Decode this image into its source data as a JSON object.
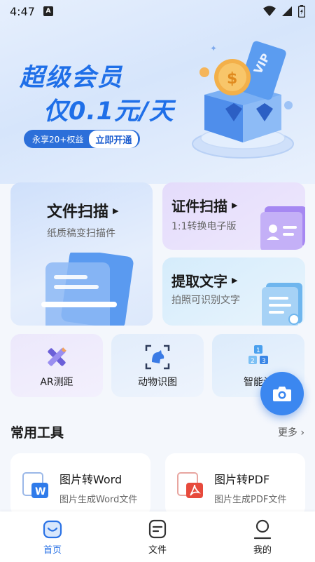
{
  "status": {
    "time": "4:47",
    "notification_icon_letter": "A",
    "icons": [
      "wifi-icon",
      "signal-icon",
      "battery-icon"
    ]
  },
  "banner": {
    "title": "超级会员",
    "subtitle": "仅0.1元/天",
    "benefit_text": "永享20+权益",
    "cta_label": "立即开通",
    "badge_text": "VIP",
    "accent_color": "#1f6fe8"
  },
  "feature_cards": {
    "doc_scan": {
      "title": "文件扫描",
      "subtitle": "纸质稿变扫描件"
    },
    "id_scan": {
      "title": "证件扫描",
      "subtitle": "1:1转换电子版"
    },
    "text_extract": {
      "title": "提取文字",
      "subtitle": "拍照可识别文字"
    }
  },
  "tools": [
    {
      "label": "AR测距",
      "icon": "ruler-pencil-icon"
    },
    {
      "label": "动物识图",
      "icon": "animal-scan-icon"
    },
    {
      "label": "智能计",
      "icon": "cube-stack-icon"
    }
  ],
  "camera_fab": {
    "icon": "camera-icon"
  },
  "common_tools": {
    "title": "常用工具",
    "more_label": "更多 ›",
    "items": [
      {
        "title": "图片转Word",
        "subtitle": "图片生成Word文件",
        "icon": "word-icon",
        "badge": "W"
      },
      {
        "title": "图片转PDF",
        "subtitle": "图片生成PDF文件",
        "icon": "pdf-icon"
      }
    ]
  },
  "bottom_nav": {
    "items": [
      {
        "label": "首页",
        "icon": "home-icon",
        "active": true
      },
      {
        "label": "文件",
        "icon": "file-icon",
        "active": false
      },
      {
        "label": "我的",
        "icon": "profile-icon",
        "active": false
      }
    ],
    "active_color": "#2a72e5"
  }
}
